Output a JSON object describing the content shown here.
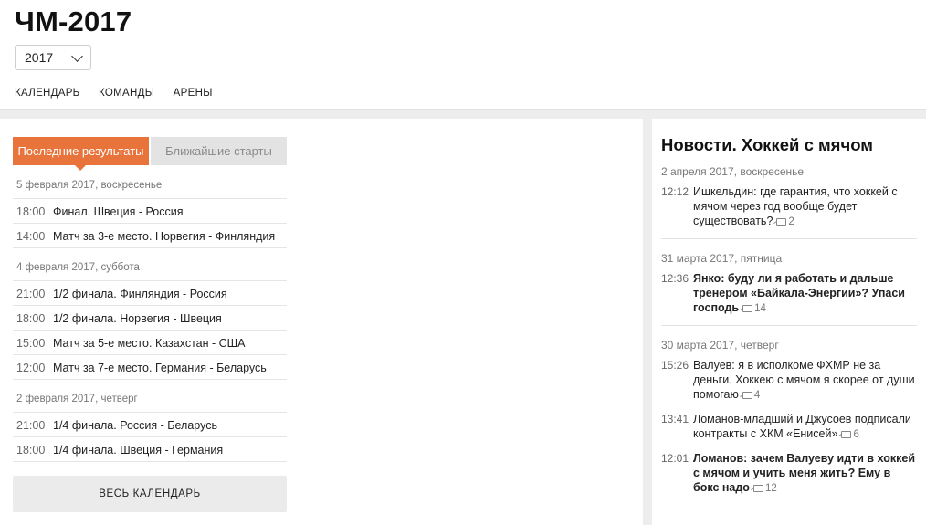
{
  "page": {
    "title": "ЧМ-2017",
    "year_select": "2017",
    "nav": [
      "КАЛЕНДАРЬ",
      "КОМАНДЫ",
      "АРЕНЫ"
    ]
  },
  "tabs": {
    "results": "Последние результаты",
    "upcoming": "Ближайшие старты"
  },
  "results": [
    {
      "date": "5 февраля 2017, воскресенье",
      "matches": [
        {
          "time": "18:00",
          "stage": "Финал.",
          "teams": "Швеция - Россия"
        },
        {
          "time": "14:00",
          "stage": "Матч за 3-е место.",
          "teams": "Норвегия - Финляндия"
        }
      ]
    },
    {
      "date": "4 февраля 2017, суббота",
      "matches": [
        {
          "time": "21:00",
          "stage": "1/2 финала.",
          "teams": "Финляндия - Россия"
        },
        {
          "time": "18:00",
          "stage": "1/2 финала.",
          "teams": "Норвегия - Швеция"
        },
        {
          "time": "15:00",
          "stage": "Матч за 5-е место.",
          "teams": "Казахстан - США"
        },
        {
          "time": "12:00",
          "stage": "Матч за 7-е место.",
          "teams": "Германия - Беларусь"
        }
      ]
    },
    {
      "date": "2 февраля 2017, четверг",
      "matches": [
        {
          "time": "21:00",
          "stage": "1/4 финала.",
          "teams": "Россия - Беларусь"
        },
        {
          "time": "18:00",
          "stage": "1/4 финала.",
          "teams": "Швеция - Германия"
        }
      ]
    }
  ],
  "calendar_button": "ВЕСЬ КАЛЕНДАРЬ",
  "news": {
    "title": "Новости. Хоккей с мячом",
    "groups": [
      {
        "date": "2 апреля 2017, воскресенье",
        "items": [
          {
            "time": "12:12",
            "text": "Ишкельдин: где гарантия, что хоккей с мячом через год вообще будет существовать?",
            "comments": "2",
            "bold": false
          }
        ]
      },
      {
        "date": "31 марта 2017, пятница",
        "items": [
          {
            "time": "12:36",
            "text": "Янко: буду ли я работать и дальше тренером «Байкала-Энергии»? Упаси господь",
            "comments": "14",
            "bold": true
          }
        ]
      },
      {
        "date": "30 марта 2017, четверг",
        "items": [
          {
            "time": "15:26",
            "text": "Валуев: я в исполкоме ФХМР не за деньги. Хоккею с мячом я скорее от души помогаю",
            "comments": "4",
            "bold": false
          },
          {
            "time": "13:41",
            "text": "Ломанов-младший и Джусоев подписали контракты с ХКМ «Енисей»",
            "comments": "6",
            "bold": false
          },
          {
            "time": "12:01",
            "text": "Ломанов: зачем Валуеву идти в хоккей с мячом и учить меня жить? Ему в бокс надо",
            "comments": "12",
            "bold": true
          }
        ]
      }
    ]
  },
  "colors": {
    "accent": "#e8743b",
    "background": "#ededed"
  }
}
